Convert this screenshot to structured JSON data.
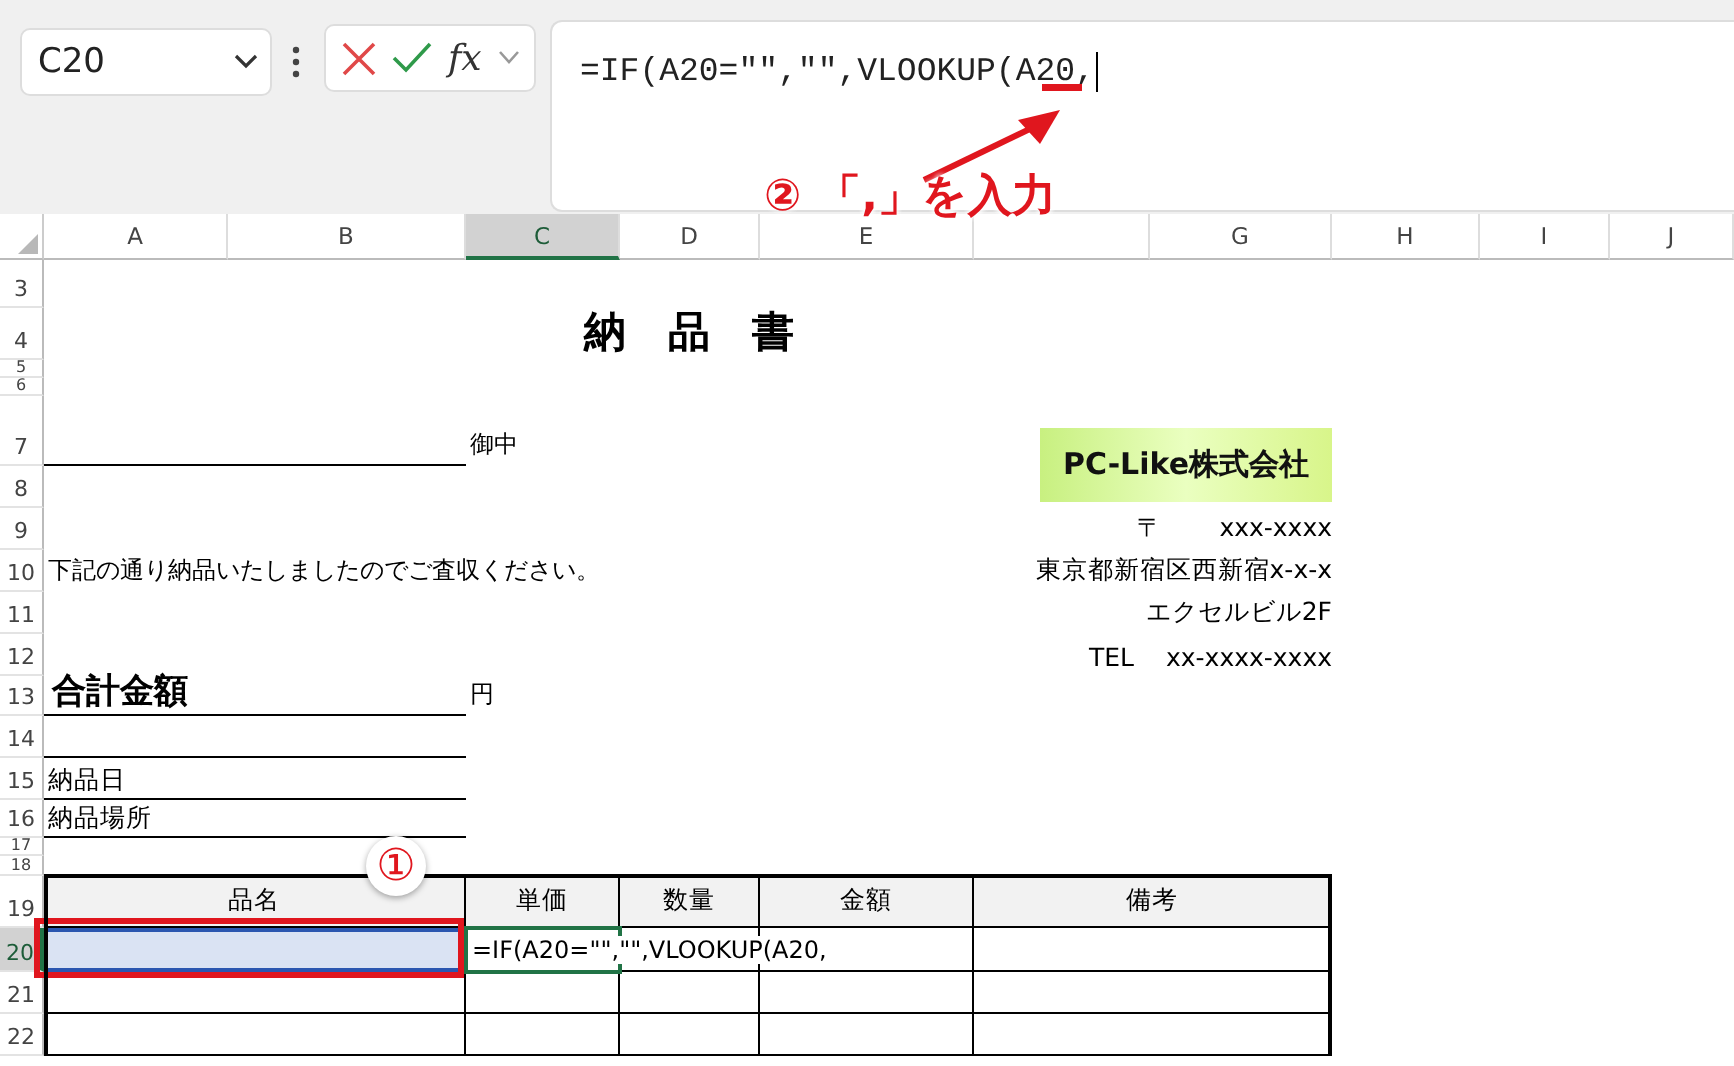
{
  "name_box": {
    "value": "C20"
  },
  "formula_bar": {
    "fx": "fx",
    "value": "=IF(A20=\"\",\"\",VLOOKUP(A20,"
  },
  "column_headers": [
    {
      "label": "A",
      "selected": false
    },
    {
      "label": "B",
      "selected": false
    },
    {
      "label": "C",
      "selected": true
    },
    {
      "label": "D",
      "selected": false
    },
    {
      "label": "E",
      "selected": false
    },
    {
      "selected": false
    },
    {
      "label": "G",
      "selected": false
    },
    {
      "label": "H",
      "selected": false
    },
    {
      "label": "I",
      "selected": false
    },
    {
      "label": "J",
      "selected": false
    }
  ],
  "row_headers": [
    {
      "label": "3",
      "selected": false
    },
    {
      "label": "4",
      "selected": false
    },
    {
      "label": "5",
      "selected": false
    },
    {
      "label": "6",
      "selected": false
    },
    {
      "label": "7",
      "selected": false
    },
    {
      "label": "8",
      "selected": false
    },
    {
      "label": "9",
      "selected": false
    },
    {
      "label": "10",
      "selected": false
    },
    {
      "label": "11",
      "selected": false
    },
    {
      "label": "12",
      "selected": false
    },
    {
      "label": "13",
      "selected": false
    },
    {
      "label": "14",
      "selected": false
    },
    {
      "label": "15",
      "selected": false
    },
    {
      "label": "16",
      "selected": false
    },
    {
      "label": "17",
      "selected": false
    },
    {
      "label": "18",
      "selected": false
    },
    {
      "label": "19",
      "selected": false
    },
    {
      "label": "20",
      "selected": true
    },
    {
      "label": "21",
      "selected": false
    },
    {
      "label": "22",
      "selected": false
    }
  ],
  "document": {
    "title": "納　品　書",
    "recipient_suffix": "御中",
    "message": "下記の通り納品いたしましたのでご査収ください。",
    "total_label": "合計金額",
    "yen": "円",
    "delivery_date_label": "納品日",
    "delivery_place_label": "納品場所",
    "company_logo": "PC-Like株式会社",
    "postal_mark": "〒",
    "postal_code": "xxx-xxxx",
    "address": "東京都新宿区西新宿x-x-x",
    "building": "エクセルビル2F",
    "tel_label": "TEL",
    "tel": "xx-xxxx-xxxx"
  },
  "table": {
    "columns": [
      "品名",
      "単価",
      "数量",
      "金額",
      "備考"
    ],
    "rows": [
      {
        "selected": true,
        "price": "=IF(A20=\"\",\"\",VLOOKUP(A20,"
      },
      {
        "selected": false
      },
      {
        "selected": false
      }
    ]
  },
  "annotations": {
    "step_two_number": "②",
    "step_two_text": "「,」を入力",
    "step_one_number": "①"
  }
}
